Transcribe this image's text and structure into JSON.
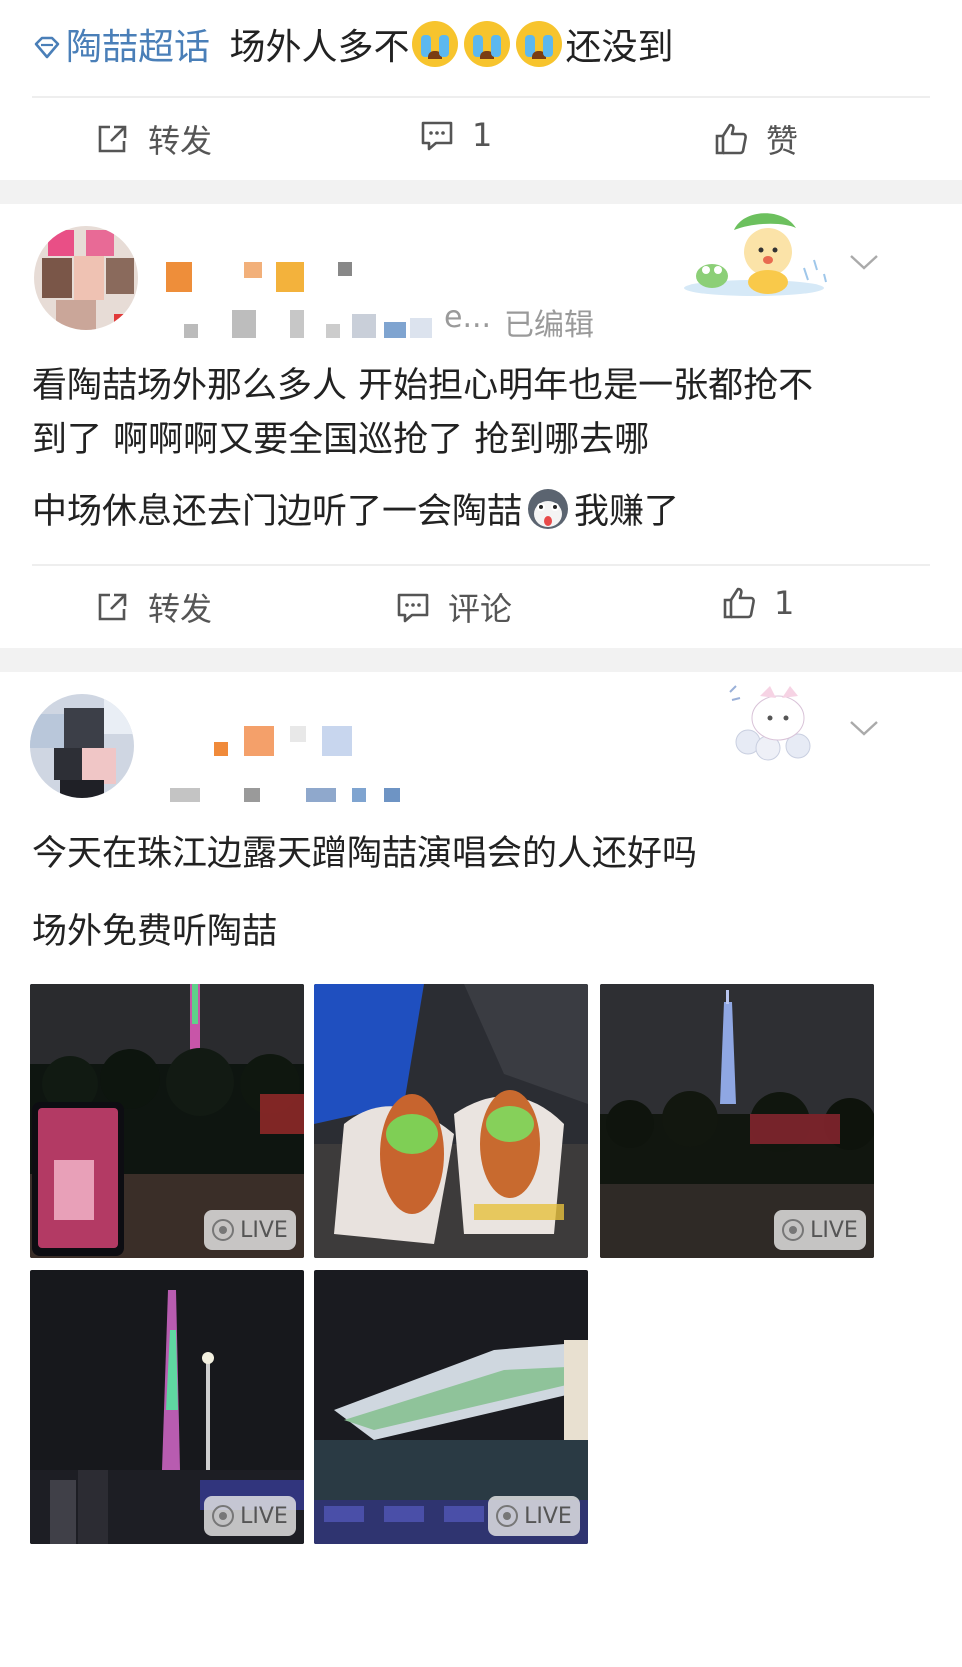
{
  "post1": {
    "topic_name": "陶喆超话",
    "text_before": "场外人多不",
    "emoji": "crying-emoji",
    "text_after": "还没到",
    "actions": {
      "repost": "转发",
      "comment_count": "1",
      "like": "赞"
    }
  },
  "post2": {
    "username_suffix": "e...",
    "edited_label": "已编辑",
    "lines": [
      "看陶喆场外那么多人 开始担心明年也是一张都抢不",
      "到了 啊啊啊又要全国巡抢了 抢到哪去哪",
      "中场休息还去门边听了一会陶喆"
    ],
    "line3_after_emoji": "我赚了",
    "emoji": "husky-emoji",
    "actions": {
      "repost": "转发",
      "comment": "评论",
      "like_count": "1"
    }
  },
  "post3": {
    "lines": [
      "今天在珠江边露天蹭陶喆演唱会的人还好吗",
      "场外免费听陶喆"
    ],
    "live_label": "LIVE"
  },
  "colors": {
    "topic_blue": "#4a7fb8",
    "separator": "#f2f2f2",
    "text": "#222222",
    "muted": "#9a9a9a"
  }
}
